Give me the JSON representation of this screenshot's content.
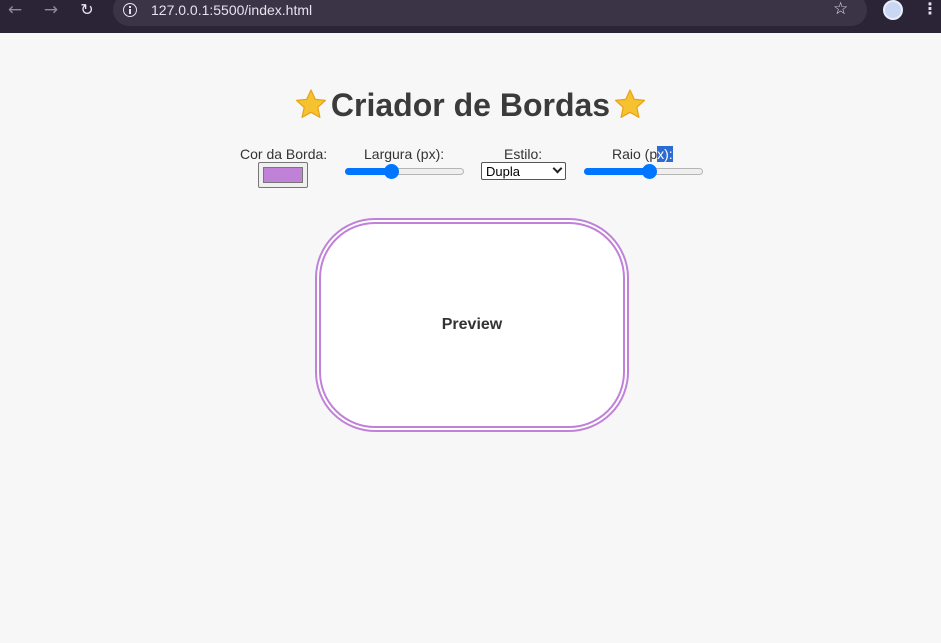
{
  "browser": {
    "url": "127.0.0.1:5500/index.html",
    "icons": [
      "back-arrow-icon",
      "forward-arrow-icon",
      "reload-icon",
      "info-icon",
      "bookmark-star-icon",
      "profile-avatar",
      "kebab-menu-icon"
    ]
  },
  "page": {
    "title": "Criador de Bordas",
    "title_emoji_icon": "star-emoji-icon"
  },
  "controls": {
    "border_color": {
      "label": "Cor da Borda:",
      "value": "#c081d9"
    },
    "width": {
      "label": "Largura (px):",
      "fraction": 0.37
    },
    "style": {
      "label": "Estilo:",
      "value": "Dupla"
    },
    "radius": {
      "label_part1": "Raio (p",
      "label_highlight": "x):",
      "fraction": 0.55
    }
  },
  "preview": {
    "label": "Preview",
    "border_color": "#c081d9",
    "border_style": "double"
  },
  "colors": {
    "accent": "#0075ff",
    "chrome_bg": "#2b2436",
    "page_bg": "#f7f7f7"
  }
}
